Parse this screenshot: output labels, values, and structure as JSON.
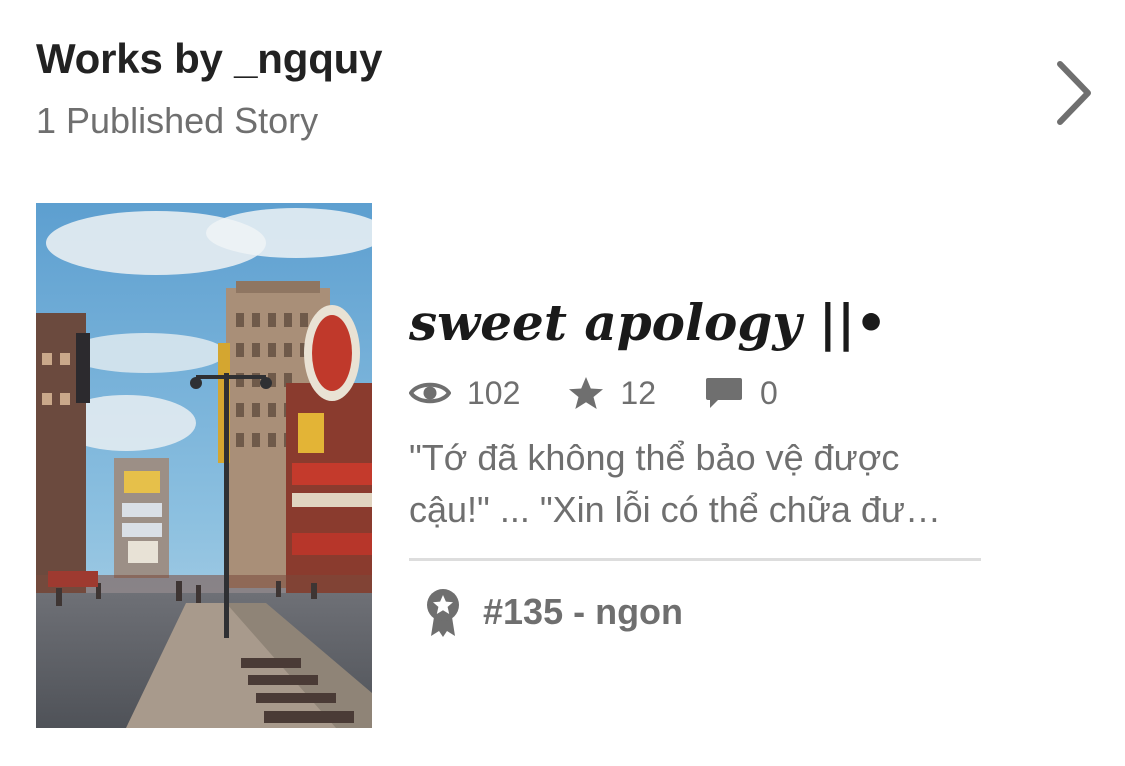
{
  "header": {
    "title": "Works by _ngquy",
    "subtitle": "1 Published Story"
  },
  "story": {
    "title": "sweet apology ||•",
    "stats": {
      "reads": "102",
      "votes": "12",
      "comments": "0"
    },
    "description_lines": [
      "\"Tớ đã không thể bảo vệ được",
      "cậu!\" ... \"Xin lỗi có thể chữa đư…"
    ],
    "rank": "#135 - ngon"
  },
  "icons": {
    "next": "chevron-right-icon",
    "reads": "eye-icon",
    "votes": "star-icon",
    "comments": "speech-bubble-icon",
    "rank": "ribbon-badge-icon"
  },
  "colors": {
    "text_primary": "#222222",
    "text_secondary": "#6f6f6f",
    "divider": "#dddddd",
    "icon": "#6f6f6f"
  }
}
